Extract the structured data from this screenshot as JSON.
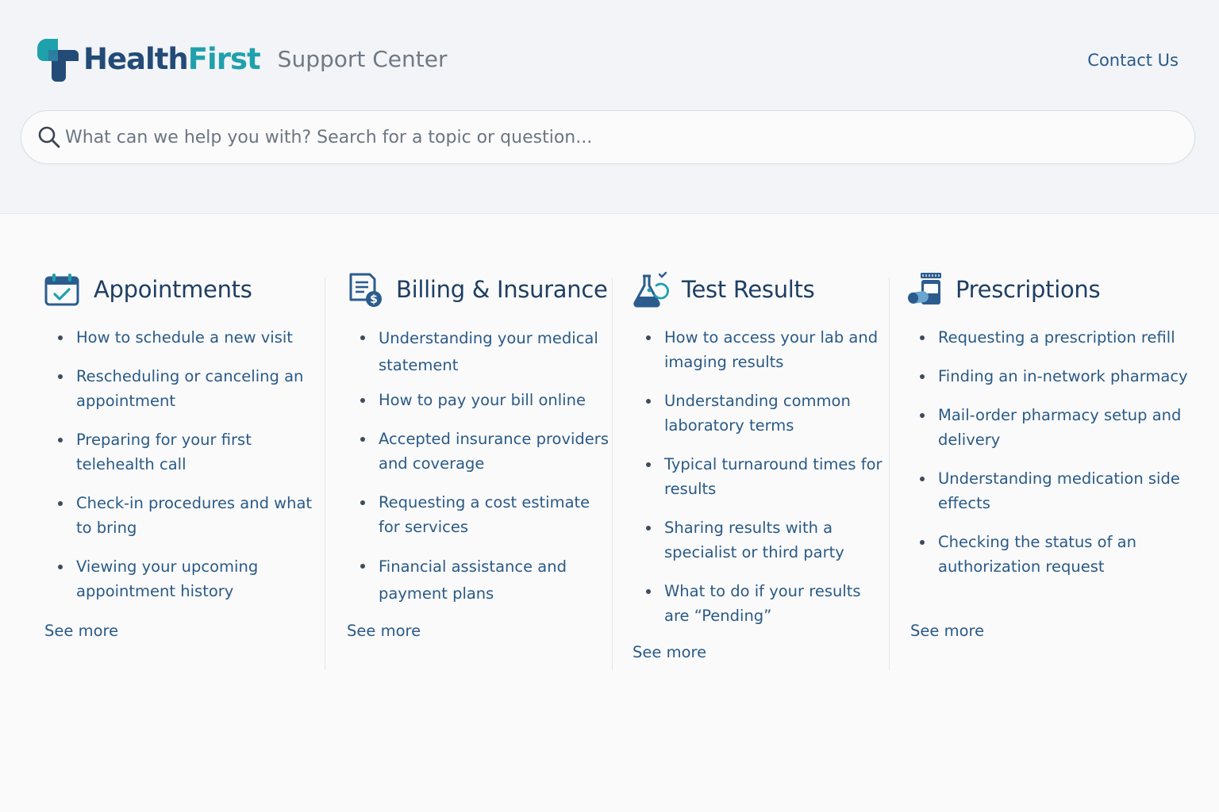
{
  "brand": {
    "name_part1": "Health",
    "name_part2": "First",
    "subtitle": "Support Center",
    "colors": {
      "navy": "#234b77",
      "teal": "#1fa1ad"
    }
  },
  "header": {
    "contact_label": "Contact Us"
  },
  "search": {
    "placeholder": "What can we help you with? Search for a topic or question...",
    "value": "",
    "icon": "search-icon"
  },
  "categories": [
    {
      "title": "Appointments",
      "icon": "calendar-check-icon",
      "items": [
        "How to schedule a new visit",
        "Rescheduling or canceling an appointment",
        "Preparing for your first telehealth call",
        "Check-in procedures and what to bring",
        "Viewing your upcoming appointment history"
      ],
      "see_more": "See more"
    },
    {
      "title": "Billing & Insurance",
      "icon": "bill-dollar-icon",
      "items": [
        "Understanding your medical statement",
        "How to pay your bill online",
        "Accepted insurance providers and coverage",
        "Requesting a cost estimate for services",
        "Financial assistance and payment plans"
      ],
      "see_more": "See more"
    },
    {
      "title": "Test Results",
      "icon": "lab-flask-icon",
      "items": [
        "How to access your lab and imaging results",
        "Understanding common laboratory terms",
        "Typical turnaround times for results",
        "Sharing results with a specialist or third party",
        "What to do if your results are “Pending”"
      ],
      "see_more": "See more"
    },
    {
      "title": "Prescriptions",
      "icon": "pill-bottle-icon",
      "items": [
        "Requesting a prescription refill",
        "Finding an in-network pharmacy",
        "Mail-order pharmacy setup and delivery",
        "Understanding medication side effects",
        "Checking the status of an authorization request"
      ],
      "see_more": "See more"
    }
  ]
}
